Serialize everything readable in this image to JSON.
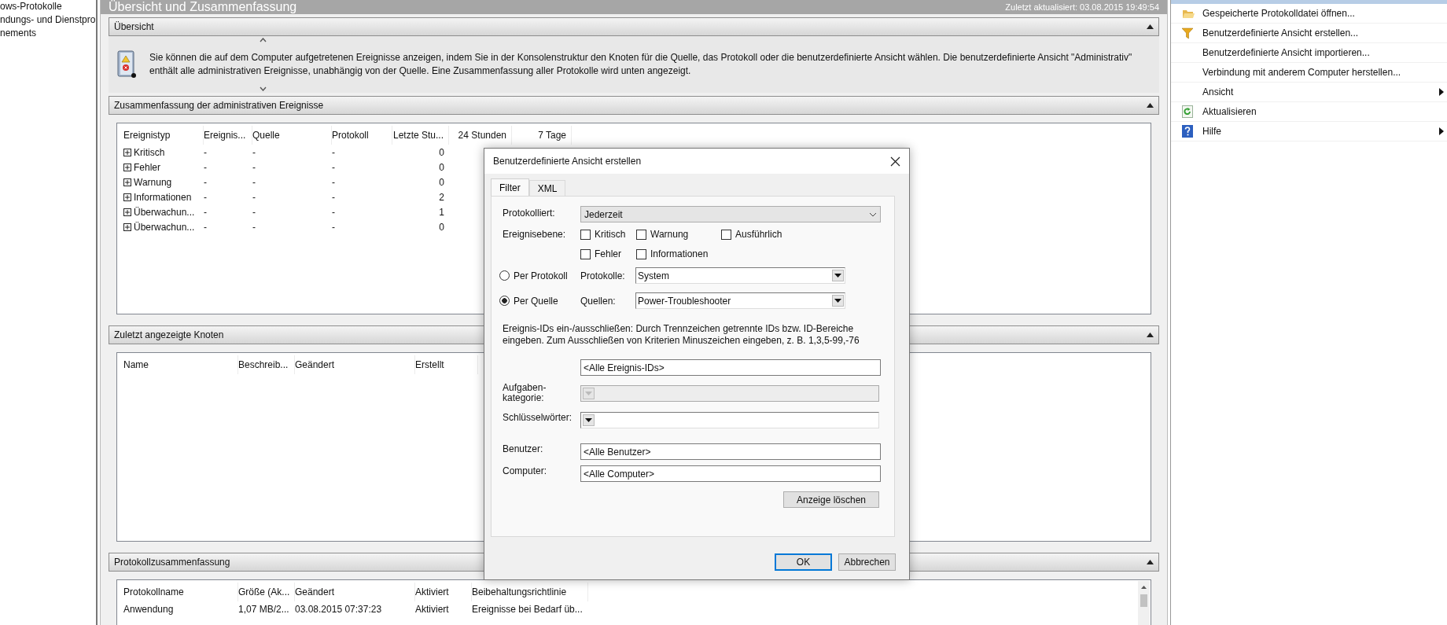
{
  "nav": {
    "items": [
      "ows-Protokolle",
      "ndungs- und Dienstpro",
      "nements"
    ]
  },
  "header": {
    "title": "Übersicht und Zusammenfassung",
    "updated": "Zuletzt aktualisiert: 03.08.2015 19:49:54"
  },
  "sections": [
    {
      "kind": "text",
      "title": "Übersicht",
      "expanded": true,
      "text": "Sie können die auf dem Computer aufgetretenen Ereignisse anzeigen, indem Sie in der Konsolenstruktur den Knoten für die Quelle, das Protokoll oder die benutzerdefinierte Ansicht wählen. Die benutzerdefinierte Ansicht \"Administrativ\" enthält alle administrativen Ereignisse, unabhängig von der Quelle. Eine Zusammenfassung aller Protokolle wird unten angezeigt."
    },
    {
      "kind": "table",
      "title": "Zusammenfassung der administrativen Ereignisse",
      "expanded": true,
      "columns": [
        "Ereignistyp",
        "Ereignis...",
        "Quelle",
        "Protokoll",
        "Letzte Stu...",
        "24 Stunden",
        "7 Tage"
      ],
      "rows": [
        {
          "expandable": true,
          "cells": [
            "Kritisch",
            "-",
            "-",
            "-",
            "0"
          ]
        },
        {
          "expandable": true,
          "cells": [
            "Fehler",
            "-",
            "-",
            "-",
            "0"
          ]
        },
        {
          "expandable": true,
          "cells": [
            "Warnung",
            "-",
            "-",
            "-",
            "0"
          ]
        },
        {
          "expandable": true,
          "cells": [
            "Informationen",
            "-",
            "-",
            "-",
            "2"
          ]
        },
        {
          "expandable": true,
          "cells": [
            "Überwachun...",
            "-",
            "-",
            "-",
            "1"
          ]
        },
        {
          "expandable": true,
          "cells": [
            "Überwachun...",
            "-",
            "-",
            "-",
            "0"
          ]
        }
      ]
    },
    {
      "kind": "table",
      "title": "Zuletzt angezeigte Knoten",
      "expanded": true,
      "columns": [
        "Name",
        "Beschreib...",
        "Geändert",
        "Erstellt"
      ]
    },
    {
      "kind": "table",
      "title": "Protokollzusammenfassung",
      "expanded": true,
      "columns": [
        "Protokollname",
        "Größe (Ak...",
        "Geändert",
        "Aktiviert",
        "Beibehaltungsrichtlinie"
      ],
      "rows": [
        {
          "cells": [
            "Anwendung",
            "1,07 MB/2...",
            "03.08.2015 07:37:23",
            "Aktiviert",
            "Ereignisse bei Bedarf üb..."
          ]
        }
      ]
    }
  ],
  "actions": {
    "items": [
      {
        "label": "Gespeicherte Protokolldatei öffnen...",
        "submenu": false
      },
      {
        "label": "Benutzerdefinierte Ansicht erstellen...",
        "submenu": false
      },
      {
        "label": "Benutzerdefinierte Ansicht importieren...",
        "submenu": false
      },
      {
        "label": "Verbindung mit anderem Computer herstellen...",
        "submenu": false
      },
      {
        "label": "Ansicht",
        "submenu": true
      },
      {
        "label": "Aktualisieren",
        "submenu": false
      },
      {
        "label": "Hilfe",
        "submenu": true
      }
    ]
  },
  "dialog": {
    "title": "Benutzerdefinierte Ansicht erstellen",
    "tabs": [
      {
        "label": "Filter",
        "selected": true
      },
      {
        "label": "XML",
        "selected": false
      }
    ],
    "logged": {
      "label": "Protokolliert:",
      "value": "Jederzeit"
    },
    "levels": {
      "label": "Ereignisebene:",
      "options": [
        {
          "label": "Kritisch",
          "checked": false
        },
        {
          "label": "Warnung",
          "checked": false
        },
        {
          "label": "Ausführlich",
          "checked": false
        },
        {
          "label": "Fehler",
          "checked": false
        },
        {
          "label": "Informationen",
          "checked": false
        }
      ]
    },
    "scope": [
      {
        "label": "Per Protokoll",
        "selected": false,
        "field_label": "Protokolle:",
        "value": "System"
      },
      {
        "label": "Per Quelle",
        "selected": true,
        "field_label": "Quellen:",
        "value": "Power-Troubleshooter"
      }
    ],
    "ids": {
      "hint": "Ereignis-IDs ein-/ausschließen: Durch Trennzeichen getrennte IDs bzw. ID-Bereiche eingeben. Zum Ausschließen von Kriterien Minuszeichen eingeben, z. B. 1,3,5-99,-76",
      "value": "<Alle Ereignis-IDs>"
    },
    "task_category": {
      "label": "Aufgaben-kategorie:",
      "disabled": true
    },
    "keywords": {
      "label": "Schlüsselwörter:",
      "disabled": false
    },
    "user": {
      "label": "Benutzer:",
      "value": "<Alle Benutzer>"
    },
    "computer": {
      "label": "Computer:",
      "value": "<Alle Computer>"
    },
    "clear_button": "Anzeige löschen",
    "buttons": [
      {
        "label": "OK",
        "default": true
      },
      {
        "label": "Abbrechen",
        "default": false
      }
    ]
  }
}
